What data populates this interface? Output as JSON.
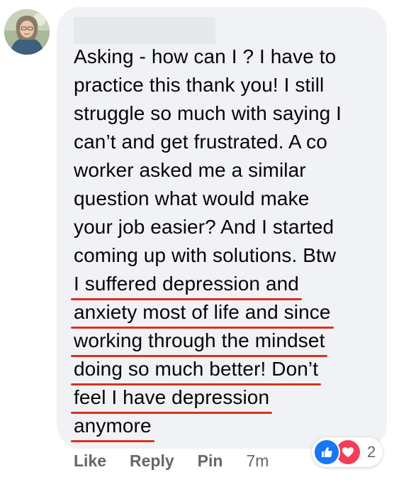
{
  "comment": {
    "lines": [
      "Asking - how can I ? I have to",
      "practice this thank you! I still",
      "struggle so much with saying I",
      "can’t and get frustrated. A co",
      "worker asked me a similar",
      "question what would make",
      "your job easier? And I started",
      "coming up with solutions. Btw",
      "I suffered depression and",
      "anxiety most of life and since",
      "working through the mindset",
      "doing so much better! Don’t",
      "feel I have depression",
      "anymore"
    ]
  },
  "actions": {
    "like": "Like",
    "reply": "Reply",
    "pin": "Pin",
    "time": "7m"
  },
  "reactions": {
    "icons": [
      "thumbs-up-icon",
      "heart-icon"
    ],
    "count": "2",
    "colors": {
      "like": "#1877f2",
      "love": "#f33e58"
    }
  },
  "colors": {
    "bubble": "#f0f2f5",
    "text": "#050505",
    "meta": "#65676b",
    "underline": "#d9331f"
  }
}
